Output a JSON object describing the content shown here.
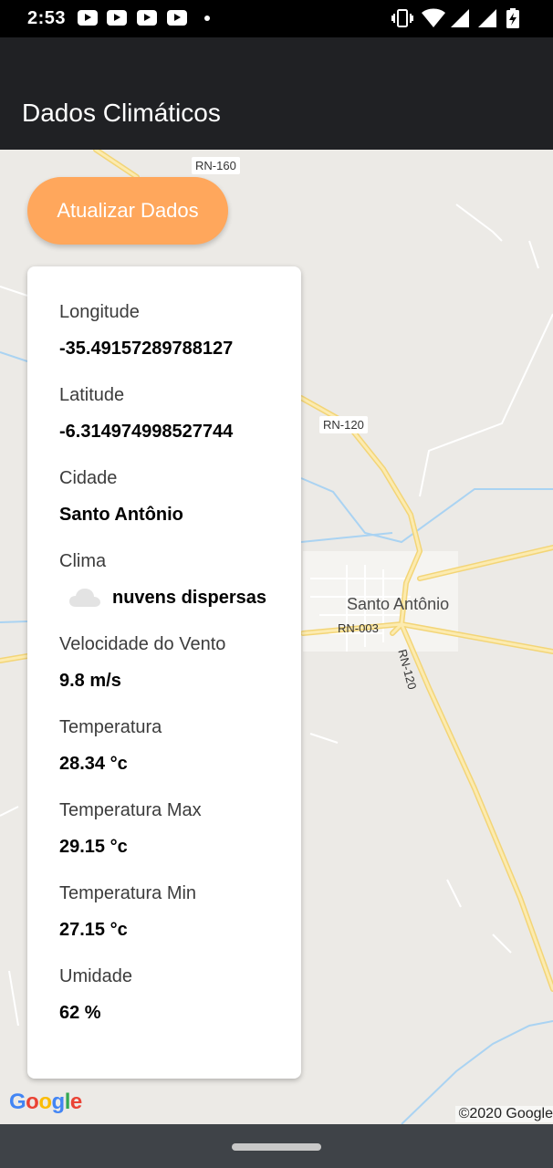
{
  "status_bar": {
    "time": "2:53",
    "notification_icons": [
      "youtube-icon",
      "youtube-icon",
      "youtube-icon",
      "youtube-icon",
      "dot-icon"
    ],
    "system_icons": [
      "vibrate-icon",
      "wifi-icon",
      "signal-icon",
      "signal-icon",
      "battery-charging-icon"
    ]
  },
  "app_bar": {
    "title": "Dados Climáticos"
  },
  "actions": {
    "update_button_label": "Atualizar Dados"
  },
  "colors": {
    "accent": "#ffa75c",
    "app_bar": "#202124",
    "road": "#f8dc7c"
  },
  "weather": {
    "longitude_label": "Longitude",
    "longitude": "-35.49157289788127",
    "latitude_label": "Latitude",
    "latitude": "-6.314974998527744",
    "city_label": "Cidade",
    "city": "Santo Antônio",
    "climate_label": "Clima",
    "climate_icon": "cloud-icon",
    "climate": "nuvens dispersas",
    "wind_label": "Velocidade do Vento",
    "wind": "9.8 m/s",
    "temp_label": "Temperatura",
    "temp": "28.34 °c",
    "temp_max_label": "Temperatura Max",
    "temp_max": "29.15 °c",
    "temp_min_label": "Temperatura Min",
    "temp_min": "27.15 °c",
    "humidity_label": "Umidade",
    "humidity": "62 %"
  },
  "map": {
    "road_labels": [
      "RN-160",
      "RN-120",
      "RN-003",
      "RN-120"
    ],
    "place_label": "Santo Antônio",
    "attribution": "©2020 Google",
    "logo_letters": [
      "G",
      "o",
      "o",
      "g",
      "l",
      "e"
    ]
  }
}
